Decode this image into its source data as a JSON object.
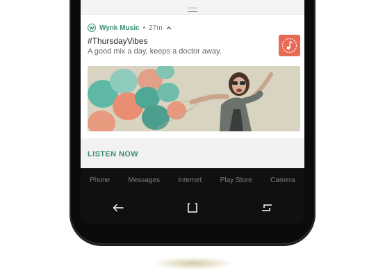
{
  "notification": {
    "app_name": "Wynk Music",
    "separator": "•",
    "time": "27m",
    "title": "#ThursdayVibes",
    "body": "A good mix a day, keeps a doctor away.",
    "action": "LISTEN NOW",
    "icons": {
      "app": "wynk-music-icon",
      "expand": "chevron-up-icon",
      "thumbnail": "music-note-icon"
    }
  },
  "dock": {
    "apps": [
      "Phone",
      "Messages",
      "Internet",
      "Play Store",
      "Camera"
    ]
  },
  "navbar": {
    "icons": [
      "back-icon",
      "home-icon",
      "recents-icon"
    ]
  },
  "colors": {
    "accent": "#3a8f6e",
    "thumbnail": "#e86a55",
    "phone_body": "#0b0b0c"
  }
}
